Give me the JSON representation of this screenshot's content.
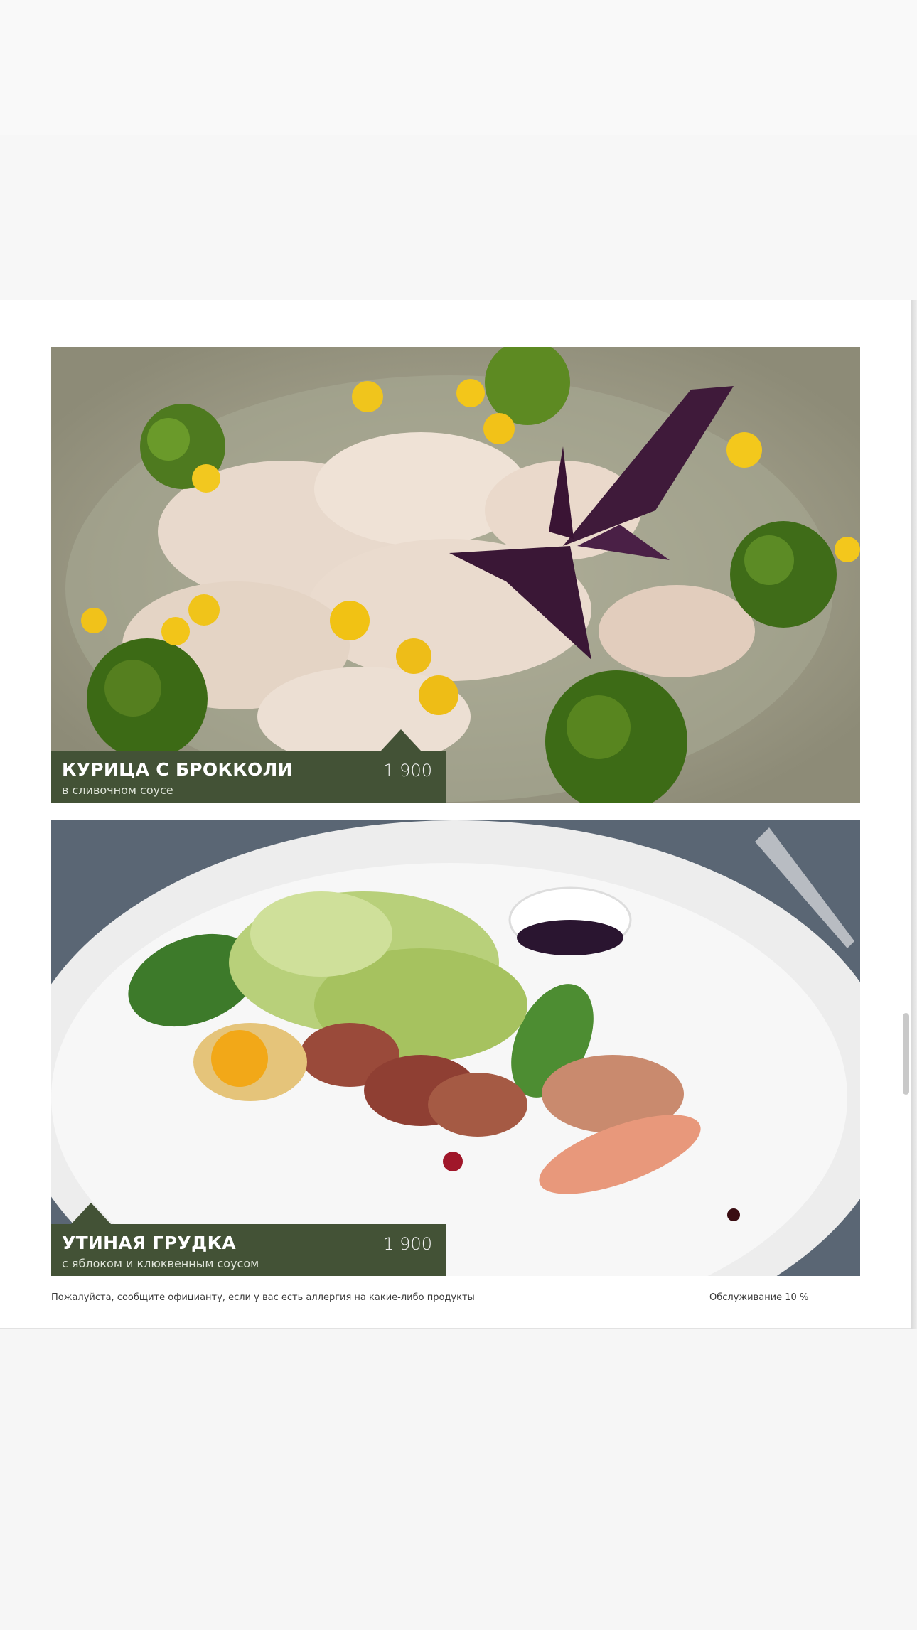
{
  "dishes": [
    {
      "name": "КУРИЦА С БРОККОЛИ",
      "description": "в сливочном соусе",
      "price": "1 900",
      "photo_icon": "chicken-broccoli-photo"
    },
    {
      "name": "УТИНАЯ ГРУДКА",
      "description": "с яблоком и клюквенным соусом",
      "price": "1 900",
      "photo_icon": "duck-breast-photo"
    }
  ],
  "footer": {
    "allergy_note": "Пожалуйста, сообщите официанту, если у вас есть аллергия на какие-либо продукты",
    "service_charge": "Обслуживание 10 %"
  },
  "colors": {
    "label_background": "#435236",
    "label_text": "#ffffff",
    "page_background": "#ffffff"
  }
}
